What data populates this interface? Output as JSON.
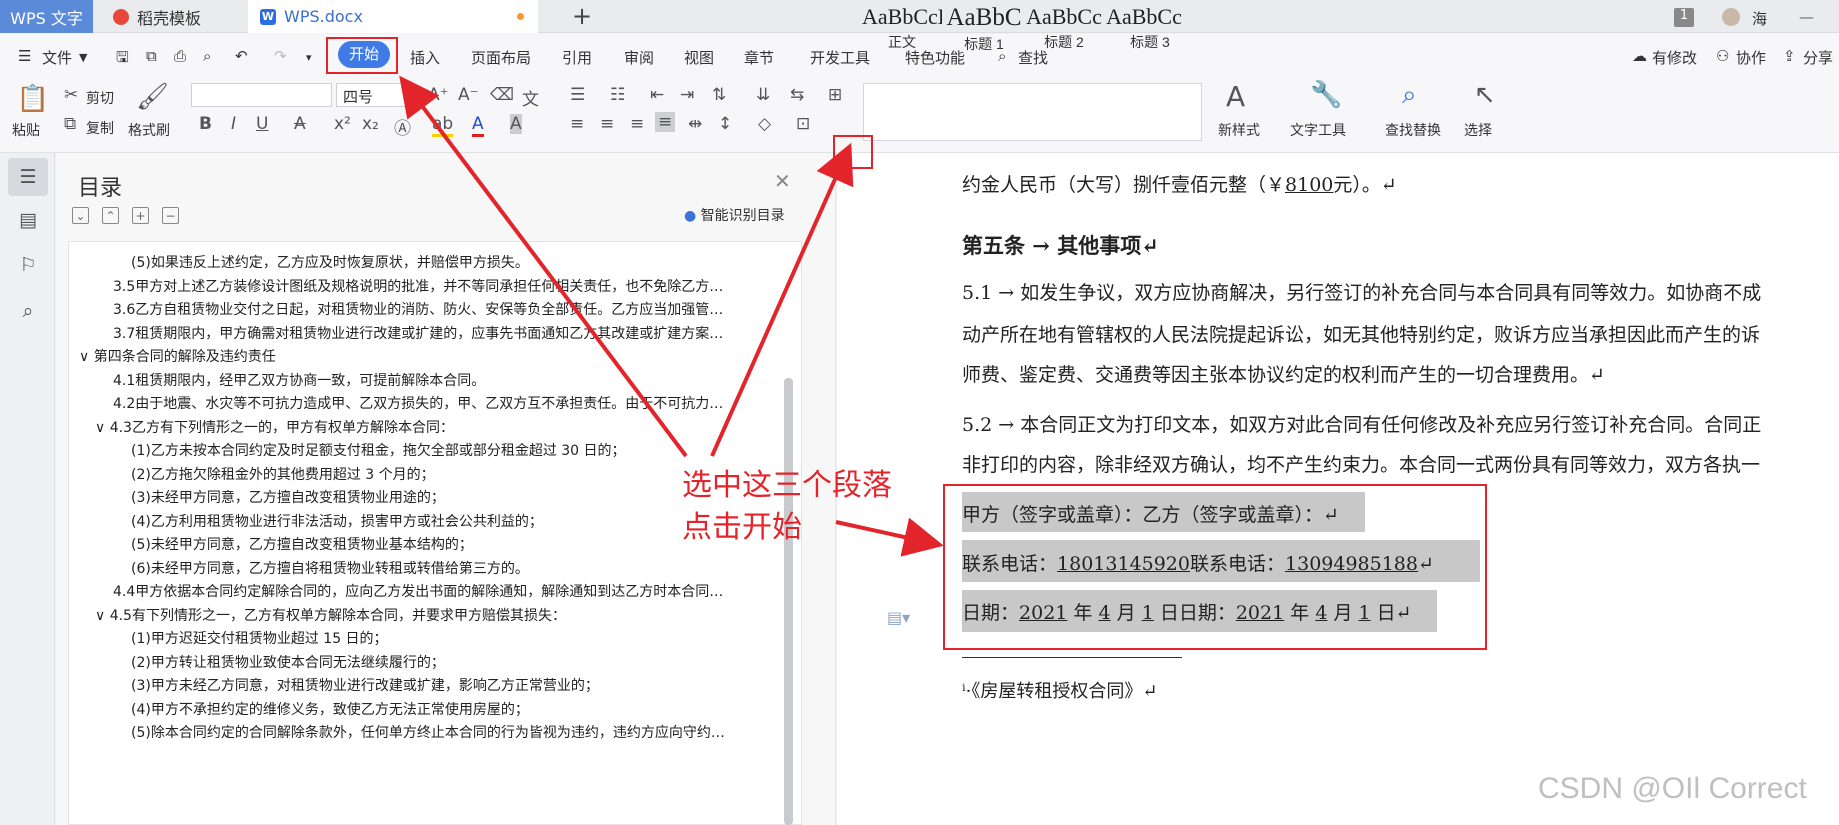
{
  "tabs": {
    "app": "WPS 文字",
    "template": "稻壳模板",
    "doc": "WPS.docx",
    "new_tab": "+"
  },
  "window": {
    "badge": "1",
    "user": "海",
    "minimize": "—",
    "maximize": "□"
  },
  "menu": {
    "file": "文件",
    "items": [
      "开始",
      "插入",
      "页面布局",
      "引用",
      "审阅",
      "视图",
      "章节",
      "开发工具",
      "特色功能"
    ],
    "search": "查找",
    "right": [
      "有修改",
      "协作",
      "分享"
    ]
  },
  "toolbar": {
    "paste": "粘贴",
    "cut": "剪切",
    "copy": "复制",
    "format_painter": "格式刷",
    "font_name": "",
    "font_size": "四号",
    "new_style": "新样式",
    "text_tool": "文字工具",
    "find_replace": "查找替换",
    "select": "选择"
  },
  "styles": [
    {
      "preview": "AaBbCcDd",
      "name": "正文"
    },
    {
      "preview": "AaBbC",
      "name": "标题 1"
    },
    {
      "preview": "AaBbCc",
      "name": "标题 2"
    },
    {
      "preview": "AaBbCc",
      "name": "标题 3"
    }
  ],
  "toc": {
    "title": "目录",
    "smart": "智能识别目录",
    "items": [
      {
        "text": "(5)如果违反上述约定，乙方应及时恢复原状，并赔偿甲方损失。",
        "level": 3
      },
      {
        "text": "3.5甲方对上述乙方装修设计图纸及规格说明的批准，并不等同承担任何相关责任，也不免除乙方…",
        "level": 2
      },
      {
        "text": "3.6乙方自租赁物业交付之日起，对租赁物业的消防、防火、安保等负全部责任。乙方应当加强管…",
        "level": 2
      },
      {
        "text": "3.7租赁期限内，甲方确需对租赁物业进行改建或扩建的，应事先书面通知乙方其改建或扩建方案…",
        "level": 2
      },
      {
        "text": "第四条合同的解除及违约责任",
        "level": 1
      },
      {
        "text": "4.1租赁期限内，经甲乙双方协商一致，可提前解除本合同。",
        "level": 2
      },
      {
        "text": "4.2由于地震、水灾等不可抗力造成甲、乙双方损失的，甲、乙双方互不承担责任。由于不可抗力…",
        "level": 2
      },
      {
        "text": "4.3乙方有下列情形之一的，甲方有权单方解除本合同：",
        "level": 2
      },
      {
        "text": "(1)乙方未按本合同约定及时足额支付租金，拖欠全部或部分租金超过 30 日的；",
        "level": 3
      },
      {
        "text": "(2)乙方拖欠除租金外的其他费用超过 3 个月的；",
        "level": 3
      },
      {
        "text": "(3)未经甲方同意，乙方擅自改变租赁物业用途的；",
        "level": 3
      },
      {
        "text": "(4)乙方利用租赁物业进行非法活动，损害甲方或社会公共利益的；",
        "level": 3
      },
      {
        "text": "(5)未经甲方同意，乙方擅自改变租赁物业基本结构的；",
        "level": 3
      },
      {
        "text": "(6)未经甲方同意，乙方擅自将租赁物业转租或转借给第三方的。",
        "level": 3
      },
      {
        "text": "4.4甲方依据本合同约定解除合同的，应向乙方发出书面的解除通知，解除通知到达乙方时本合同…",
        "level": 2
      },
      {
        "text": "4.5有下列情形之一，乙方有权单方解除本合同，并要求甲方赔偿其损失：",
        "level": 2
      },
      {
        "text": "(1)甲方迟延交付租赁物业超过 15 日的；",
        "level": 3
      },
      {
        "text": "(2)甲方转让租赁物业致使本合同无法继续履行的；",
        "level": 3
      },
      {
        "text": "(3)甲方未经乙方同意，对租赁物业进行改建或扩建，影响乙方正常营业的；",
        "level": 3
      },
      {
        "text": "(4)甲方不承担约定的维修义务，致使乙方无法正常使用房屋的；",
        "level": 3
      },
      {
        "text": "(5)除本合同约定的合同解除条款外，任何单方终止本合同的行为皆视为违约，违约方应向守约…",
        "level": 3
      }
    ]
  },
  "doc": {
    "l1_pre": "约金人民币（大写）捌仟壹佰元整（￥",
    "l1_amt": "8100",
    "l1_post": "元）。↵",
    "heading": "第五条 → 其他事项↵",
    "p1a": "5.1 → 如发生争议，双方应协商解决，另行签订的补充合同与本合同具有同等效力。如协商不成",
    "p1b": "动产所在地有管辖权的人民法院提起诉讼，如无其他特别约定，败诉方应当承担因此而产生的诉",
    "p1c": "师费、鉴定费、交通费等因主张本协议约定的权利而产生的一切合理费用。↵",
    "p2a": "5.2 → 本合同正文为打印文本，如双方对此合同有任何修改及补充应另行签订补充合同。合同正",
    "p2b": "非打印的内容，除非经双方确认，均不产生约束力。本合同一式两份具有同等效力，双方各执一",
    "s1": "甲方（签字或盖章）：乙方（签字或盖章）：↵",
    "s2_l": "联系电话：",
    "s2_n1": "18013145920",
    "s2_m": "联系电话：",
    "s2_n2": "13094985188",
    "s2_e": "↵",
    "s3_l": "日期：",
    "s3_y1": "2021",
    "s3_a": "年",
    "s3_m1": "4",
    "s3_b": "月",
    "s3_d1": "1",
    "s3_c": "日日期：",
    "s3_y2": "2021",
    "s3_e": "年",
    "s3_m2": "4",
    "s3_f": "月",
    "s3_d2": "1",
    "s3_g": "日↵",
    "footnote": "ⁱ·《房屋转租授权合同》↵"
  },
  "annotation": {
    "line1": "选中这三个段落",
    "line2": "点击开始",
    "color": "#e4242b"
  },
  "watermark": "CSDN @OIl Correct"
}
